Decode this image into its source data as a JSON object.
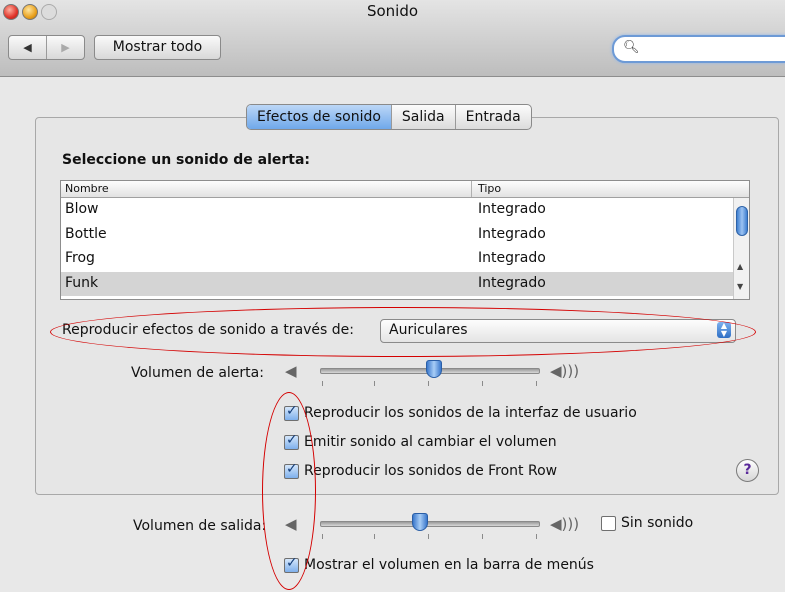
{
  "window": {
    "title": "Sonido"
  },
  "toolbar": {
    "back_glyph": "◀",
    "forward_glyph": "▶",
    "show_all_label": "Mostrar todo",
    "search_placeholder": "",
    "search_icon": "magnifier-icon"
  },
  "tabs": [
    {
      "label": "Efectos de sonido",
      "selected": true
    },
    {
      "label": "Salida",
      "selected": false
    },
    {
      "label": "Entrada",
      "selected": false
    }
  ],
  "alerts": {
    "heading": "Seleccione un sonido de alerta:",
    "columns": [
      "Nombre",
      "Tipo"
    ],
    "rows": [
      {
        "name": "Blow",
        "type": "Integrado",
        "selected": false
      },
      {
        "name": "Bottle",
        "type": "Integrado",
        "selected": false
      },
      {
        "name": "Frog",
        "type": "Integrado",
        "selected": false
      },
      {
        "name": "Funk",
        "type": "Integrado",
        "selected": true
      }
    ]
  },
  "playthrough": {
    "label": "Reproducir efectos de sonido a través de:",
    "value": "Auriculares"
  },
  "alert_volume": {
    "label": "Volumen de alerta:",
    "level": 0.52
  },
  "options": [
    {
      "label": "Reproducir los sonidos de la interfaz de usuario",
      "checked": true
    },
    {
      "label": "Emitir sonido al cambiar el volumen",
      "checked": true
    },
    {
      "label": "Reproducir los sonidos de Front Row",
      "checked": true
    }
  ],
  "help": {
    "glyph": "?"
  },
  "output_volume": {
    "label": "Volumen de salida:",
    "level": 0.45,
    "mute_label": "Sin sonido",
    "mute_checked": false
  },
  "menubar_option": {
    "label": "Mostrar el volumen en la barra de menús",
    "checked": true
  },
  "colors": {
    "accent": "#6fa8ea",
    "annotation": "#d40000",
    "selected_row": "#d4d4d4"
  }
}
